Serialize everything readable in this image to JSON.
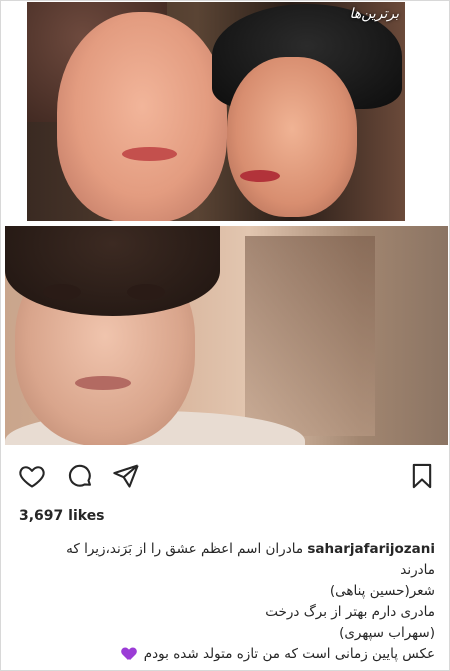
{
  "post": {
    "watermark": "برترین‌ها",
    "likes": "3,697 likes",
    "username": "saharjafarijozani",
    "caption_lines": [
      "مادران اسم اعظم عشق را از بَرَند،زیرا که مادرند",
      "شعر(حسین پناهی)",
      "مادری دارم بهتر از برگ درخت",
      "(سهراب سپهری)",
      "عکس پایین زمانی است که من تازه متولد شده بودم"
    ],
    "caption_first_line_text": "مادران اسم اعظم عشق را از بَرَند،زیرا که",
    "caption_first_line_wrap": "مادرند"
  },
  "icons": {
    "like": "heart-outline-icon",
    "comment": "comment-bubble-icon",
    "share": "paper-plane-icon",
    "save": "bookmark-icon",
    "emoji": "purple-heart-icon"
  },
  "colors": {
    "text": "#262626",
    "emoji": "#9b3cd6"
  }
}
